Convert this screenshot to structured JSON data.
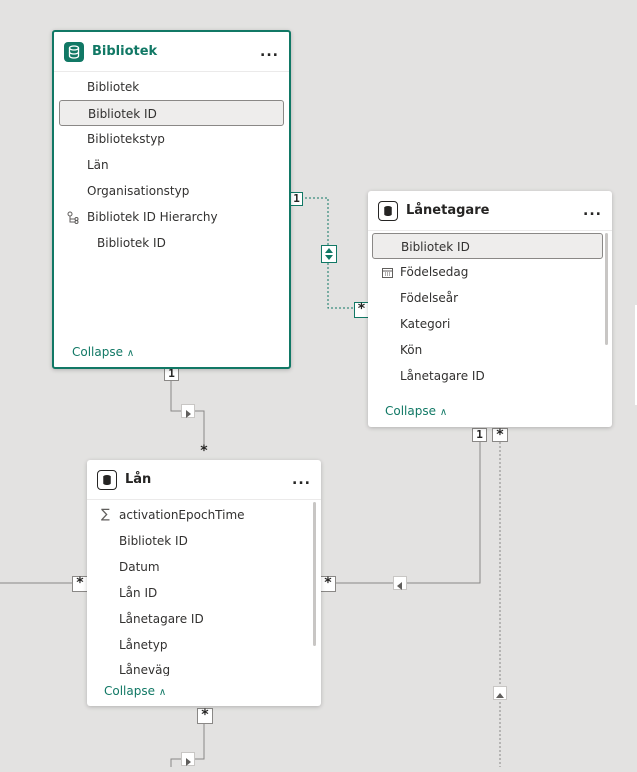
{
  "tables": {
    "bibliotek": {
      "title": "Bibliotek",
      "more_label": "...",
      "fields": [
        "Bibliotek",
        "Bibliotek ID",
        "Bibliotekstyp",
        "Län",
        "Organisationstyp",
        "Bibliotek ID Hierarchy",
        "Bibliotek ID"
      ],
      "collapse_label": "Collapse"
    },
    "lanetagare": {
      "title": "Lånetagare",
      "more_label": "...",
      "fields": [
        "Bibliotek ID",
        "Födelsedag",
        "Födelseår",
        "Kategori",
        "Kön",
        "Lånetagare ID"
      ],
      "collapse_label": "Collapse"
    },
    "lan": {
      "title": "Lån",
      "more_label": "...",
      "fields": [
        "activationEpochTime",
        "Bibliotek ID",
        "Datum",
        "Lån ID",
        "Lånetagare ID",
        "Lånetyp",
        "Låneväg"
      ],
      "collapse_label": "Collapse"
    }
  },
  "cardinality": {
    "one": "1",
    "many": "*"
  },
  "colors": {
    "accent": "#117865",
    "canvas": "#e3e2e1",
    "line": "#8a8886"
  }
}
